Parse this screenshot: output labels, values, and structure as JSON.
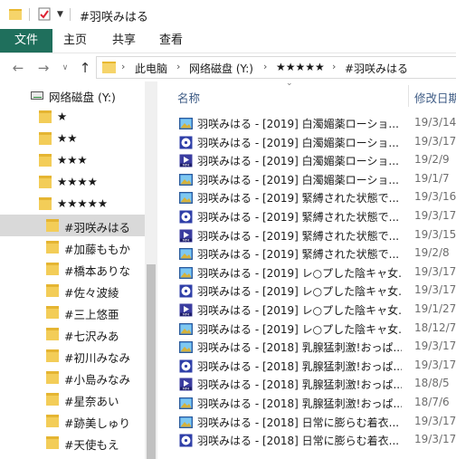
{
  "window": {
    "title": "#羽咲みはる"
  },
  "ribbon": {
    "tabs": [
      "文件",
      "主页",
      "共享",
      "查看"
    ]
  },
  "address": {
    "crumbs": [
      "此电脑",
      "网络磁盘 (Y:)",
      "★★★★★",
      "#羽咲みはる"
    ]
  },
  "nav": {
    "drive_label": "网络磁盘 (Y:)",
    "items": [
      {
        "label": "★",
        "level": 1,
        "selected": false
      },
      {
        "label": "★★",
        "level": 1,
        "selected": false
      },
      {
        "label": "★★★",
        "level": 1,
        "selected": false
      },
      {
        "label": "★★★★",
        "level": 1,
        "selected": false
      },
      {
        "label": "★★★★★",
        "level": 1,
        "selected": false
      },
      {
        "label": "#羽咲みはる",
        "level": 2,
        "selected": true
      },
      {
        "label": "#加藤ももか",
        "level": 2,
        "selected": false
      },
      {
        "label": "#橋本ありな",
        "level": 2,
        "selected": false
      },
      {
        "label": "#佐々波綾",
        "level": 2,
        "selected": false
      },
      {
        "label": "#三上悠亜",
        "level": 2,
        "selected": false
      },
      {
        "label": "#七沢みあ",
        "level": 2,
        "selected": false
      },
      {
        "label": "#初川みなみ",
        "level": 2,
        "selected": false
      },
      {
        "label": "#小島みなみ",
        "level": 2,
        "selected": false
      },
      {
        "label": "#星奈あい",
        "level": 2,
        "selected": false
      },
      {
        "label": "#跡美しゅり",
        "level": 2,
        "selected": false
      },
      {
        "label": "#天使もえ",
        "level": 2,
        "selected": false
      }
    ]
  },
  "columns": {
    "name": "名称",
    "modified": "修改日期"
  },
  "files": [
    {
      "name": "羽咲みはる - [2019] 白濁媚薬ローショ...",
      "date": "19/3/14",
      "icon": "image-icon"
    },
    {
      "name": "羽咲みはる - [2019] 白濁媚薬ローショ...",
      "date": "19/3/17",
      "icon": "disc-icon"
    },
    {
      "name": "羽咲みはる - [2019] 白濁媚薬ローショ...",
      "date": "19/2/9",
      "icon": "mp4-icon"
    },
    {
      "name": "羽咲みはる - [2019] 白濁媚薬ローショ...",
      "date": "19/1/7",
      "icon": "image-icon"
    },
    {
      "name": "羽咲みはる - [2019] 緊縛された状態で...",
      "date": "19/3/16",
      "icon": "image-icon"
    },
    {
      "name": "羽咲みはる - [2019] 緊縛された状態で...",
      "date": "19/3/17",
      "icon": "disc-icon"
    },
    {
      "name": "羽咲みはる - [2019] 緊縛された状態で...",
      "date": "19/3/15",
      "icon": "mp4-icon"
    },
    {
      "name": "羽咲みはる - [2019] 緊縛された状態で...",
      "date": "19/2/8",
      "icon": "image-icon"
    },
    {
      "name": "羽咲みはる - [2019] レ○プした陰キャ女...",
      "date": "19/3/17",
      "icon": "image-icon"
    },
    {
      "name": "羽咲みはる - [2019] レ○プした陰キャ女...",
      "date": "19/3/17",
      "icon": "disc-icon"
    },
    {
      "name": "羽咲みはる - [2019] レ○プした陰キャ女...",
      "date": "19/1/27",
      "icon": "mp4-icon"
    },
    {
      "name": "羽咲みはる - [2019] レ○プした陰キャ女...",
      "date": "18/12/7",
      "icon": "image-icon"
    },
    {
      "name": "羽咲みはる - [2018] 乳腺猛刺激!おっぱ...",
      "date": "19/3/17",
      "icon": "image-icon"
    },
    {
      "name": "羽咲みはる - [2018] 乳腺猛刺激!おっぱ...",
      "date": "19/3/17",
      "icon": "disc-icon"
    },
    {
      "name": "羽咲みはる - [2018] 乳腺猛刺激!おっぱ...",
      "date": "18/8/5",
      "icon": "mp4-icon"
    },
    {
      "name": "羽咲みはる - [2018] 乳腺猛刺激!おっぱ...",
      "date": "18/7/6",
      "icon": "image-icon"
    },
    {
      "name": "羽咲みはる - [2018] 日常に膨らむ着衣...",
      "date": "19/3/17",
      "icon": "image-icon"
    },
    {
      "name": "羽咲みはる - [2018] 日常に膨らむ着衣...",
      "date": "19/3/17",
      "icon": "disc-icon"
    }
  ],
  "colors": {
    "file_tab": "#1f6f5c",
    "folder": "#f2c94c",
    "selected_row": "#d9d9d9",
    "header_text": "#3c5a84"
  }
}
